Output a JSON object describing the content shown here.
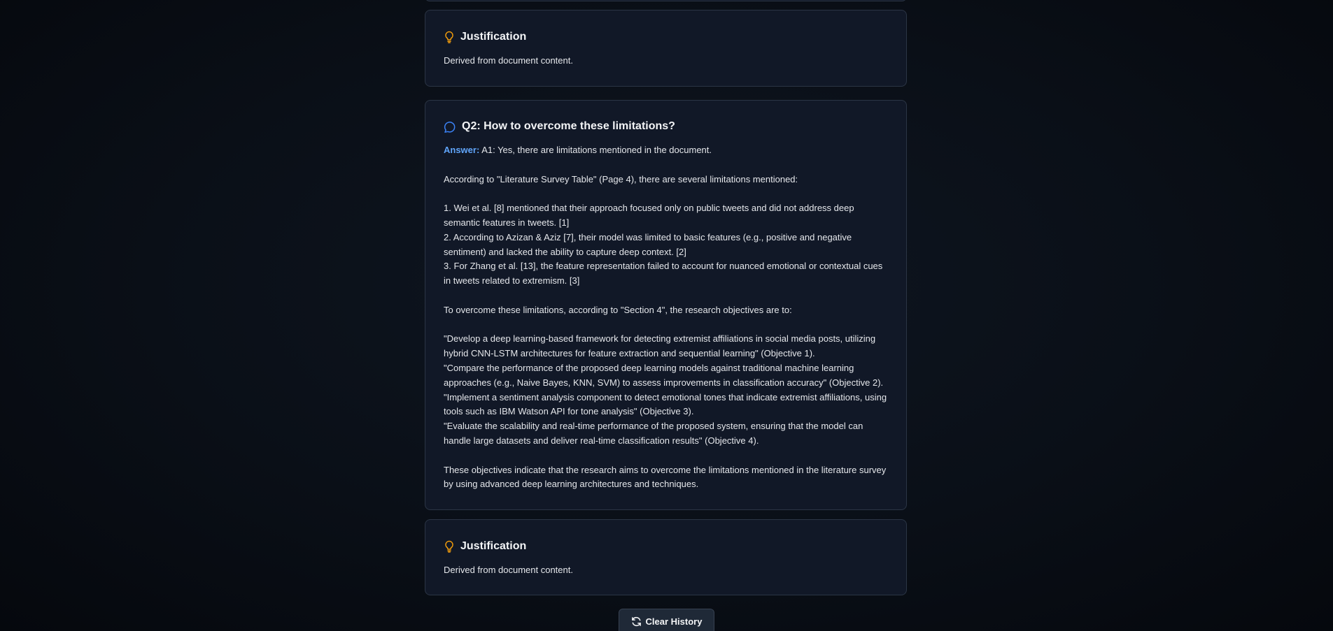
{
  "cards": {
    "justification_1": {
      "title": "Justification",
      "icon": "lightbulb-icon",
      "text": "Derived from document content."
    },
    "question_2": {
      "title": "Q2: How to overcome these limitations?",
      "icon": "message-bubble-icon",
      "answer_label": "Answer:",
      "answer_first_line": " A1: Yes, there are limitations mentioned in the document.",
      "answer_lines": [
        "",
        "According to \"Literature Survey Table\" (Page 4), there are several limitations mentioned:",
        "",
        "1. Wei et al. [8] mentioned that their approach focused only on public tweets and did not address deep semantic features in tweets. [1]",
        "2. According to Azizan & Aziz [7], their model was limited to basic features (e.g., positive and negative sentiment) and lacked the ability to capture deep context. [2]",
        "3. For Zhang et al. [13], the feature representation failed to account for nuanced emotional or contextual cues in tweets related to extremism. [3]",
        "",
        "To overcome these limitations, according to \"Section 4\", the research objectives are to:",
        "",
        "\"Develop a deep learning-based framework for detecting extremist affiliations in social media posts, utilizing hybrid CNN-LSTM architectures for feature extraction and sequential learning\" (Objective 1).",
        "\"Compare the performance of the proposed deep learning models against traditional machine learning approaches (e.g., Naive Bayes, KNN, SVM) to assess improvements in classification accuracy\" (Objective 2).",
        "\"Implement a sentiment analysis component to detect emotional tones that indicate extremist affiliations, using tools such as IBM Watson API for tone analysis\" (Objective 3).",
        "\"Evaluate the scalability and real-time performance of the proposed system, ensuring that the model can handle large datasets and deliver real-time classification results\" (Objective 4).",
        "",
        "These objectives indicate that the research aims to overcome the limitations mentioned in the literature survey by using advanced deep learning architectures and techniques."
      ]
    },
    "justification_2": {
      "title": "Justification",
      "icon": "lightbulb-icon",
      "text": "Derived from document content."
    }
  },
  "actions": {
    "clear_history_label": "Clear History",
    "clear_history_icon": "refresh-icon"
  },
  "colors": {
    "accent_blue": "#60a5fa",
    "icon_orange": "#f59e0b",
    "icon_blue": "#3b82f6",
    "card_bg": "#111827",
    "card_border": "#2b3545"
  }
}
